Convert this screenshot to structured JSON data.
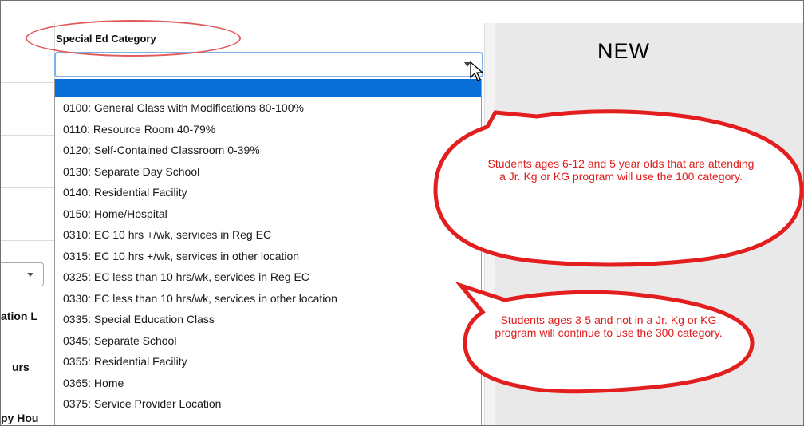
{
  "field": {
    "label": "Special Ed Category"
  },
  "panel": {
    "new_label": "NEW"
  },
  "left_labels": {
    "location": "ation L",
    "hours": "urs",
    "therapy_hours": "py Hou"
  },
  "dropdown": {
    "selected_value": "",
    "options": [
      "0100: General Class with Modifications 80-100%",
      "0110: Resource Room 40-79%",
      "0120: Self-Contained Classroom 0-39%",
      "0130: Separate Day School",
      "0140: Residential Facility",
      "0150: Home/Hospital",
      "0310: EC 10 hrs +/wk, services in Reg EC",
      "0315: EC 10 hrs +/wk, services in other location",
      "0325: EC less than 10 hrs/wk, services in Reg EC",
      "0330: EC less than 10 hrs/wk, services in other location",
      "0335: Special Education Class",
      "0345: Separate School",
      "0355: Residential Facility",
      "0365: Home",
      "0375: Service Provider Location"
    ]
  },
  "callouts": {
    "top": "Students ages 6-12 and 5 year olds that are  attending a Jr. Kg or KG program will use the 100 category.",
    "bottom": "Students ages 3-5 and not in a Jr. Kg or KG program will continue to use the 300 category."
  },
  "colors": {
    "callout_border": "#e31e1e",
    "callout_text": "#e11b1b",
    "selected_option": "#0a6fd6",
    "focus_border": "#7fb0e6"
  }
}
